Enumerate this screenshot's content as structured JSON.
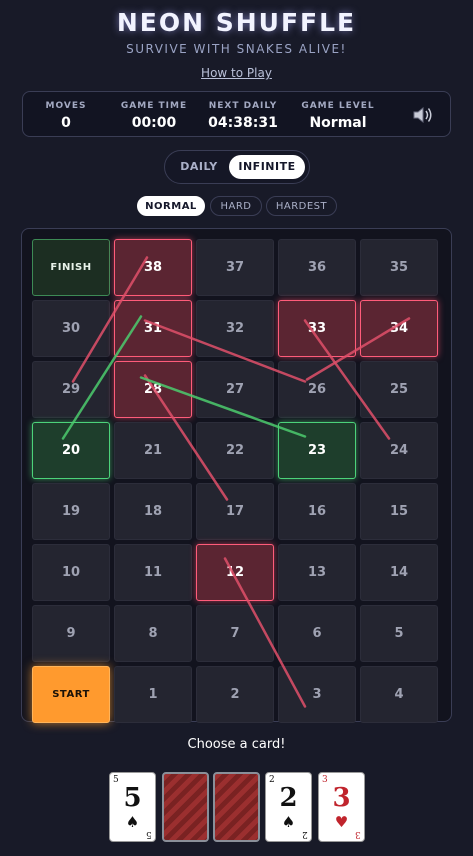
{
  "header": {
    "title": "NEON SHUFFLE",
    "subtitle": "SURVIVE WITH SNAKES ALIVE!",
    "how_to_play": "How to Play"
  },
  "stats": {
    "moves_label": "MOVES",
    "moves": "0",
    "game_time_label": "GAME TIME",
    "game_time": "00:00",
    "next_daily_label": "NEXT DAILY",
    "next_daily": "04:38:31",
    "game_level_label": "GAME LEVEL",
    "game_level": "Normal"
  },
  "modes": {
    "daily": "DAILY",
    "infinite": "INFINITE",
    "active": "INFINITE"
  },
  "levels": {
    "normal": "NORMAL",
    "hard": "HARD",
    "hardest": "HARDEST",
    "active": "NORMAL"
  },
  "board": {
    "rows": [
      [
        {
          "label": "FINISH",
          "type": "finish"
        },
        {
          "label": "38",
          "type": "red"
        },
        {
          "label": "37",
          "type": "plain"
        },
        {
          "label": "36",
          "type": "plain"
        },
        {
          "label": "35",
          "type": "plain"
        }
      ],
      [
        {
          "label": "30",
          "type": "plain"
        },
        {
          "label": "31",
          "type": "red"
        },
        {
          "label": "32",
          "type": "plain"
        },
        {
          "label": "33",
          "type": "red"
        },
        {
          "label": "34",
          "type": "red"
        }
      ],
      [
        {
          "label": "29",
          "type": "plain"
        },
        {
          "label": "28",
          "type": "red"
        },
        {
          "label": "27",
          "type": "plain"
        },
        {
          "label": "26",
          "type": "plain"
        },
        {
          "label": "25",
          "type": "plain"
        }
      ],
      [
        {
          "label": "20",
          "type": "green"
        },
        {
          "label": "21",
          "type": "plain"
        },
        {
          "label": "22",
          "type": "plain"
        },
        {
          "label": "23",
          "type": "green"
        },
        {
          "label": "24",
          "type": "plain"
        }
      ],
      [
        {
          "label": "19",
          "type": "plain"
        },
        {
          "label": "18",
          "type": "plain"
        },
        {
          "label": "17",
          "type": "plain"
        },
        {
          "label": "16",
          "type": "plain"
        },
        {
          "label": "15",
          "type": "plain"
        }
      ],
      [
        {
          "label": "10",
          "type": "plain"
        },
        {
          "label": "11",
          "type": "plain"
        },
        {
          "label": "12",
          "type": "red"
        },
        {
          "label": "13",
          "type": "plain"
        },
        {
          "label": "14",
          "type": "plain"
        }
      ],
      [
        {
          "label": "9",
          "type": "plain"
        },
        {
          "label": "8",
          "type": "plain"
        },
        {
          "label": "7",
          "type": "plain"
        },
        {
          "label": "6",
          "type": "plain"
        },
        {
          "label": "5",
          "type": "plain"
        }
      ],
      [
        {
          "label": "START",
          "type": "start"
        },
        {
          "label": "1",
          "type": "plain"
        },
        {
          "label": "2",
          "type": "plain"
        },
        {
          "label": "3",
          "type": "plain"
        },
        {
          "label": "4",
          "type": "plain"
        }
      ]
    ],
    "snakes": [
      {
        "from": "38",
        "to": "29"
      },
      {
        "from": "31",
        "to": "26"
      },
      {
        "from": "34",
        "to": "26"
      },
      {
        "from": "33",
        "to": "24"
      },
      {
        "from": "28",
        "to": "17"
      },
      {
        "from": "12",
        "to": "3"
      }
    ],
    "ladders": [
      {
        "from": "20",
        "to": "31"
      },
      {
        "from": "23",
        "to": "28"
      }
    ],
    "colors": {
      "snake": "#e0506a",
      "ladder": "#4ccc6e"
    }
  },
  "prompt": "Choose a card!",
  "cards": [
    {
      "rank": "5",
      "suit": "♠",
      "color": "black",
      "face": "up"
    },
    {
      "face": "down"
    },
    {
      "face": "down"
    },
    {
      "rank": "2",
      "suit": "♠",
      "color": "black",
      "face": "up"
    },
    {
      "rank": "3",
      "suit": "♥",
      "color": "red",
      "face": "up"
    }
  ]
}
